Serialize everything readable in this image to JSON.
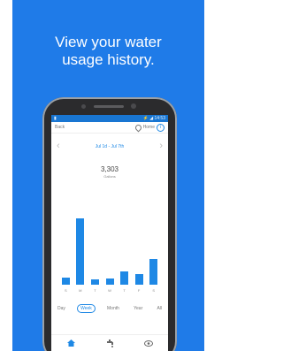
{
  "headline": {
    "line1": "View your water",
    "line2": "usage history."
  },
  "status_bar": {
    "left": "▮",
    "right": "⚡ ◢ 14:53"
  },
  "app_bar": {
    "back_label": "Back",
    "home_label": "Home",
    "info_glyph": "i"
  },
  "range": {
    "label": "Jul 1d - Jul 7th"
  },
  "total": {
    "value": "3,303",
    "unit": "Gallons"
  },
  "chart_data": {
    "type": "bar",
    "categories": [
      "S",
      "M",
      "T",
      "W",
      "T",
      "F",
      "S"
    ],
    "values": [
      9,
      82,
      7,
      8,
      17,
      13,
      32
    ],
    "ylim": [
      0,
      90
    ]
  },
  "periods": [
    "Day",
    "Week",
    "Month",
    "Year",
    "All"
  ],
  "active_period_index": 1,
  "bottom_nav": {
    "icons": [
      "home-icon",
      "faucet-icon",
      "eye-icon"
    ]
  },
  "colors": {
    "promo_bg": "#1f7be8",
    "accent": "#1e88e5"
  }
}
